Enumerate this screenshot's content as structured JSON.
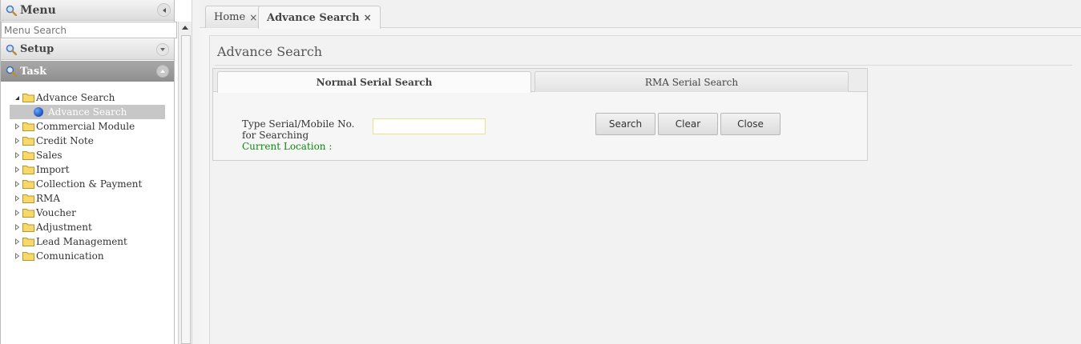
{
  "sidebar": {
    "menu_title": "Menu",
    "search_placeholder": "Menu Search",
    "sections": [
      {
        "label": "Setup",
        "icon": "magnifier-icon",
        "expanded": false
      },
      {
        "label": "Task",
        "icon": "magnifier-icon",
        "expanded": true
      }
    ],
    "tree": [
      {
        "label": "Advance Search",
        "expanded": true,
        "children": [
          {
            "label": "Advance Search",
            "selected": true
          }
        ]
      },
      {
        "label": "Commercial Module"
      },
      {
        "label": "Credit Note"
      },
      {
        "label": "Sales"
      },
      {
        "label": "Import"
      },
      {
        "label": "Collection & Payment"
      },
      {
        "label": "RMA"
      },
      {
        "label": "Voucher"
      },
      {
        "label": "Adjustment"
      },
      {
        "label": "Lead Management"
      },
      {
        "label": "Comunication"
      }
    ]
  },
  "tabs": [
    {
      "label": "Home",
      "close": "×",
      "active": false
    },
    {
      "label": "Advance Search",
      "close": "×",
      "active": true
    }
  ],
  "page": {
    "title": "Advance Search",
    "panel_tabs": [
      {
        "label": "Normal Serial Search",
        "active": true
      },
      {
        "label": "RMA Serial Search",
        "active": false
      }
    ],
    "field_label": "Type Serial/Mobile No. for Searching",
    "location_label": "Current Location :",
    "serial_value": "",
    "buttons": {
      "search": "Search",
      "clear": "Clear",
      "close": "Close"
    }
  },
  "colors": {
    "task_header": "#999999",
    "location_text": "#0d8a0d",
    "selected_item": "#c7c7c7"
  }
}
